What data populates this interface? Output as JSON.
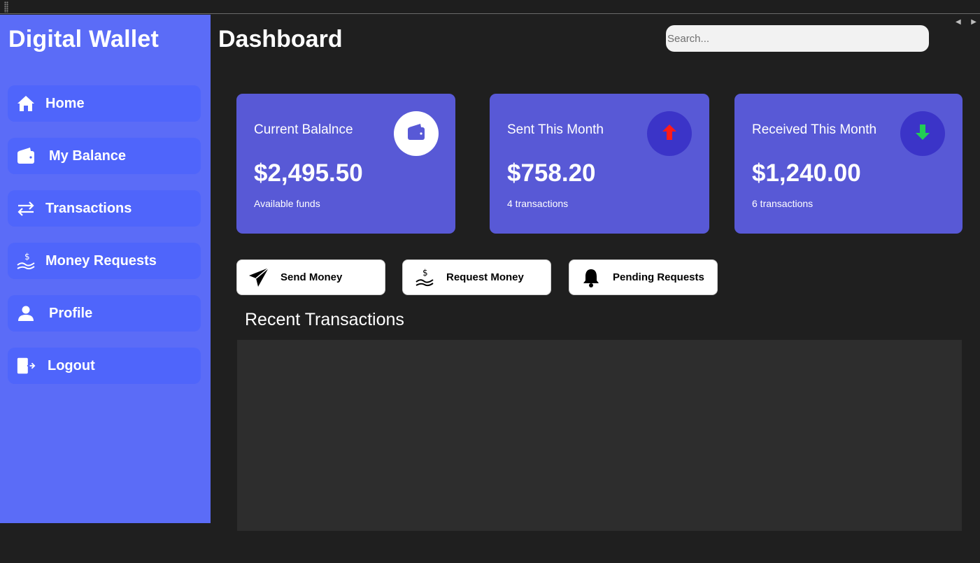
{
  "app": {
    "title": "Digital Wallet"
  },
  "sidebar": {
    "items": [
      {
        "label": "Home",
        "icon": "home-icon"
      },
      {
        "label": "My Balance",
        "icon": "wallet-icon"
      },
      {
        "label": "Transactions",
        "icon": "transfer-arrows-icon"
      },
      {
        "label": "Money Requests",
        "icon": "hand-dollar-icon"
      },
      {
        "label": "Profile",
        "icon": "user-icon"
      },
      {
        "label": "Logout",
        "icon": "logout-icon"
      }
    ]
  },
  "header": {
    "title": "Dashboard",
    "search_placeholder": "Search..."
  },
  "cards": [
    {
      "label": "Current Balalnce",
      "value": "$2,495.50",
      "sub": "Available funds",
      "icon": "wallet-icon",
      "icon_color": "#5859d6"
    },
    {
      "label": "Sent This Month",
      "value": "$758.20",
      "sub": "4 transactions",
      "icon": "arrow-up-icon",
      "icon_color": "#ff1a1a"
    },
    {
      "label": "Received This Month",
      "value": "$1,240.00",
      "sub": "6 transactions",
      "icon": "arrow-down-icon",
      "icon_color": "#22cc55"
    }
  ],
  "actions": [
    {
      "label": "Send Money",
      "icon": "paper-plane-icon"
    },
    {
      "label": "Request Money",
      "icon": "hand-dollar-icon"
    },
    {
      "label": "Pending Requests",
      "icon": "bell-icon"
    }
  ],
  "recent": {
    "title": "Recent Transactions",
    "rows": []
  },
  "colors": {
    "sidebar_bg": "#5b6cf7",
    "nav_item_bg": "#4f65fb",
    "card_bg": "#5859d6",
    "badge_dark": "#3b34c8",
    "page_bg": "#1f1f1f",
    "panel_bg": "#2d2d2d"
  }
}
